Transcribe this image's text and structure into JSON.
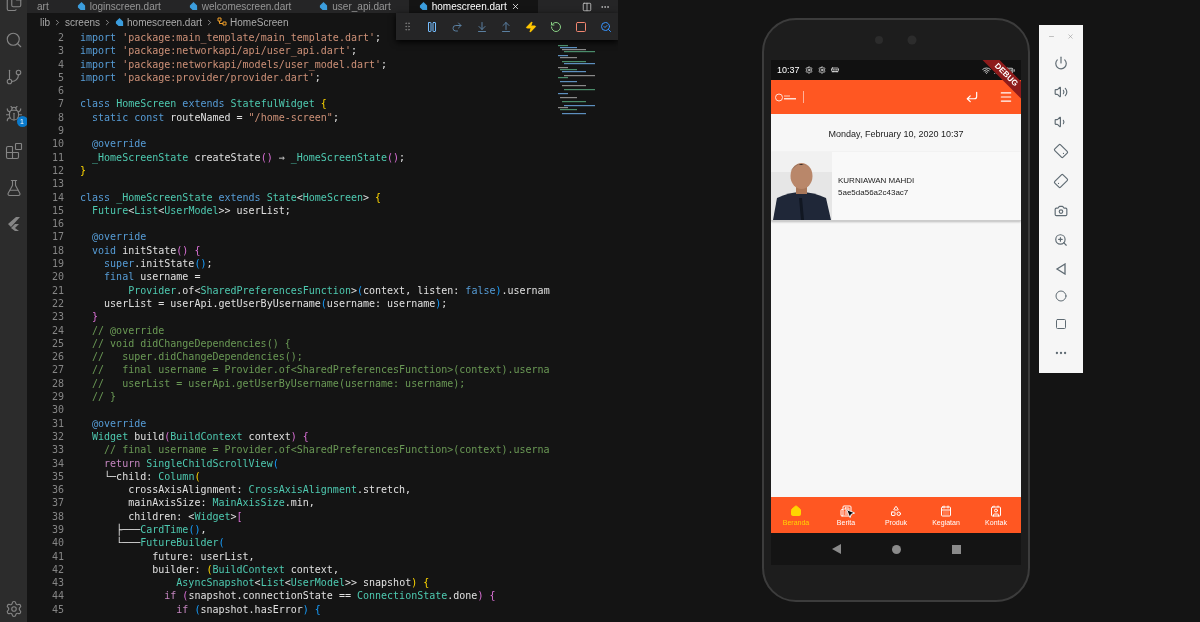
{
  "editor": {
    "activity_bar": {
      "debug_badge": "1"
    },
    "tabs": [
      {
        "label": "art",
        "kind": "cut",
        "selected": false
      },
      {
        "label": "loginscreen.dart",
        "kind": "file",
        "selected": false
      },
      {
        "label": "welcomescreen.dart",
        "kind": "file",
        "selected": false
      },
      {
        "label": "user_api.dart",
        "kind": "file",
        "selected": false
      },
      {
        "label": "homescreen.dart",
        "kind": "file",
        "selected": true
      }
    ],
    "breadcrumb": [
      {
        "label": "lib",
        "kind": "folder"
      },
      {
        "label": "screens",
        "kind": "folder"
      },
      {
        "label": "homescreen.dart",
        "kind": "file"
      },
      {
        "label": "HomeScreen",
        "kind": "class"
      }
    ],
    "lines": [
      {
        "number": "2",
        "tokens": [
          {
            "kind": "kw",
            "text": "import "
          },
          {
            "kind": "str",
            "text": "'package:main_template/main_template.dart'"
          },
          {
            "kind": "plain",
            "text": ";"
          }
        ]
      },
      {
        "number": "3",
        "tokens": [
          {
            "kind": "kw",
            "text": "import "
          },
          {
            "kind": "str",
            "text": "'package:networkapi/api/user_api.dart'"
          },
          {
            "kind": "plain",
            "text": ";"
          }
        ]
      },
      {
        "number": "4",
        "tokens": [
          {
            "kind": "kw",
            "text": "import "
          },
          {
            "kind": "str",
            "text": "'package:networkapi/models/user_model.dart'"
          },
          {
            "kind": "plain",
            "text": ";"
          }
        ]
      },
      {
        "number": "5",
        "tokens": [
          {
            "kind": "kw",
            "text": "import "
          },
          {
            "kind": "str",
            "text": "'package:provider/provider.dart'"
          },
          {
            "kind": "plain",
            "text": ";"
          }
        ]
      },
      {
        "number": "6"
      },
      {
        "number": "7",
        "tokens": [
          {
            "kind": "kw",
            "text": "class "
          },
          {
            "kind": "type",
            "text": "HomeScreen "
          },
          {
            "kind": "kw",
            "text": "extends "
          },
          {
            "kind": "type",
            "text": "StatefulWidget "
          },
          {
            "kind": "b1",
            "text": "{"
          }
        ]
      },
      {
        "number": "8",
        "tokens": [
          {
            "kind": "kw",
            "text": "  static const "
          },
          {
            "kind": "plain",
            "text": "routeNamed = "
          },
          {
            "kind": "str",
            "text": "\"/home-screen\""
          },
          {
            "kind": "plain",
            "text": ";"
          }
        ]
      },
      {
        "number": "9"
      },
      {
        "number": "10",
        "tokens": [
          {
            "kind": "kw",
            "text": "  @override"
          }
        ]
      },
      {
        "number": "11",
        "tokens": [
          {
            "kind": "type",
            "text": "  _HomeScreenState "
          },
          {
            "kind": "plain",
            "text": "createState"
          },
          {
            "kind": "b2",
            "text": "()"
          },
          {
            "kind": "plain",
            "text": " ⇒ "
          },
          {
            "kind": "type",
            "text": "_HomeScreenState"
          },
          {
            "kind": "b2",
            "text": "()"
          },
          {
            "kind": "plain",
            "text": ";"
          }
        ]
      },
      {
        "number": "12",
        "tokens": [
          {
            "kind": "b1",
            "text": "}"
          }
        ]
      },
      {
        "number": "13"
      },
      {
        "number": "14",
        "tokens": [
          {
            "kind": "kw",
            "text": "class "
          },
          {
            "kind": "type",
            "text": "_HomeScreenState "
          },
          {
            "kind": "kw",
            "text": "extends "
          },
          {
            "kind": "type",
            "text": "State"
          },
          {
            "kind": "plain",
            "text": "<"
          },
          {
            "kind": "type",
            "text": "HomeScreen"
          },
          {
            "kind": "plain",
            "text": "> "
          },
          {
            "kind": "b1",
            "text": "{"
          }
        ]
      },
      {
        "number": "15",
        "tokens": [
          {
            "kind": "type",
            "text": "  Future"
          },
          {
            "kind": "plain",
            "text": "<"
          },
          {
            "kind": "type",
            "text": "List"
          },
          {
            "kind": "plain",
            "text": "<"
          },
          {
            "kind": "type",
            "text": "UserModel"
          },
          {
            "kind": "plain",
            "text": ">> userList;"
          }
        ]
      },
      {
        "number": "16"
      },
      {
        "number": "17",
        "tokens": [
          {
            "kind": "kw",
            "text": "  @override"
          }
        ]
      },
      {
        "number": "18",
        "tokens": [
          {
            "kind": "kw",
            "text": "  void "
          },
          {
            "kind": "plain",
            "text": "initState"
          },
          {
            "kind": "b2",
            "text": "() {"
          }
        ]
      },
      {
        "number": "19",
        "tokens": [
          {
            "kind": "kw",
            "text": "    super"
          },
          {
            "kind": "plain",
            "text": ".initState"
          },
          {
            "kind": "b3",
            "text": "()"
          },
          {
            "kind": "plain",
            "text": ";"
          }
        ]
      },
      {
        "number": "20",
        "tokens": [
          {
            "kind": "kw",
            "text": "    final "
          },
          {
            "kind": "plain",
            "text": "username ="
          }
        ]
      },
      {
        "number": "21",
        "tokens": [
          {
            "kind": "type",
            "text": "        Provider"
          },
          {
            "kind": "plain",
            "text": ".of<"
          },
          {
            "kind": "type",
            "text": "SharedPreferencesFunction"
          },
          {
            "kind": "plain",
            "text": ">"
          },
          {
            "kind": "b3",
            "text": "("
          },
          {
            "kind": "plain",
            "text": "context, listen: "
          },
          {
            "kind": "kw",
            "text": "false"
          },
          {
            "kind": "b3",
            "text": ")"
          },
          {
            "kind": "plain",
            "text": ".usernam"
          }
        ]
      },
      {
        "number": "22",
        "tokens": [
          {
            "kind": "plain",
            "text": "    userList = userApi.getUserByUsername"
          },
          {
            "kind": "b3",
            "text": "("
          },
          {
            "kind": "plain",
            "text": "username: username"
          },
          {
            "kind": "b3",
            "text": ")"
          },
          {
            "kind": "plain",
            "text": ";"
          }
        ]
      },
      {
        "number": "23",
        "tokens": [
          {
            "kind": "b2",
            "text": "  }"
          }
        ]
      },
      {
        "number": "24",
        "tokens": [
          {
            "kind": "comment",
            "text": "  // @override"
          }
        ]
      },
      {
        "number": "25",
        "tokens": [
          {
            "kind": "comment",
            "text": "  // void didChangeDependencies() {"
          }
        ]
      },
      {
        "number": "26",
        "tokens": [
          {
            "kind": "comment",
            "text": "  //   super.didChangeDependencies();"
          }
        ]
      },
      {
        "number": "27",
        "tokens": [
          {
            "kind": "comment",
            "text": "  //   final username = Provider.of<SharedPreferencesFunction>(context).userna"
          }
        ]
      },
      {
        "number": "28",
        "tokens": [
          {
            "kind": "comment",
            "text": "  //   userList = userApi.getUserByUsername(username: username);"
          }
        ]
      },
      {
        "number": "29",
        "tokens": [
          {
            "kind": "comment",
            "text": "  // }"
          }
        ]
      },
      {
        "number": "30"
      },
      {
        "number": "31",
        "tokens": [
          {
            "kind": "kw",
            "text": "  @override"
          }
        ]
      },
      {
        "number": "32",
        "tokens": [
          {
            "kind": "type",
            "text": "  Widget "
          },
          {
            "kind": "plain",
            "text": "build"
          },
          {
            "kind": "b2",
            "text": "("
          },
          {
            "kind": "type",
            "text": "BuildContext "
          },
          {
            "kind": "plain",
            "text": "context"
          },
          {
            "kind": "b2",
            "text": ") {"
          }
        ]
      },
      {
        "number": "33",
        "tokens": [
          {
            "kind": "comment",
            "text": "    // final username = Provider.of<SharedPreferencesFunction>(context).userna"
          }
        ]
      },
      {
        "number": "34",
        "tokens": [
          {
            "kind": "ctrl",
            "text": "    return "
          },
          {
            "kind": "type",
            "text": "SingleChildScrollView"
          },
          {
            "kind": "b3",
            "text": "("
          }
        ]
      },
      {
        "number": "35",
        "tokens": [
          {
            "kind": "plain",
            "text": "    └─child: "
          },
          {
            "kind": "type",
            "text": "Column"
          },
          {
            "kind": "b1",
            "text": "("
          }
        ]
      },
      {
        "number": "36",
        "tokens": [
          {
            "kind": "plain",
            "text": "        crossAxisAlignment: "
          },
          {
            "kind": "type",
            "text": "CrossAxisAlignment"
          },
          {
            "kind": "plain",
            "text": ".stretch,"
          }
        ]
      },
      {
        "number": "37",
        "tokens": [
          {
            "kind": "plain",
            "text": "        mainAxisSize: "
          },
          {
            "kind": "type",
            "text": "MainAxisSize"
          },
          {
            "kind": "plain",
            "text": ".min,"
          }
        ]
      },
      {
        "number": "38",
        "tokens": [
          {
            "kind": "plain",
            "text": "        children: <"
          },
          {
            "kind": "type",
            "text": "Widget"
          },
          {
            "kind": "plain",
            "text": ">"
          },
          {
            "kind": "b2",
            "text": "["
          }
        ]
      },
      {
        "number": "39",
        "tokens": [
          {
            "kind": "plain",
            "text": "      ├───"
          },
          {
            "kind": "type",
            "text": "CardTime"
          },
          {
            "kind": "b3",
            "text": "()"
          },
          {
            "kind": "plain",
            "text": ","
          }
        ]
      },
      {
        "number": "40",
        "tokens": [
          {
            "kind": "plain",
            "text": "      └───"
          },
          {
            "kind": "type",
            "text": "FutureBuilder"
          },
          {
            "kind": "b3",
            "text": "("
          }
        ]
      },
      {
        "number": "41",
        "tokens": [
          {
            "kind": "plain",
            "text": "            future: userList,"
          }
        ]
      },
      {
        "number": "42",
        "tokens": [
          {
            "kind": "plain",
            "text": "            builder: "
          },
          {
            "kind": "b1",
            "text": "("
          },
          {
            "kind": "type",
            "text": "BuildContext "
          },
          {
            "kind": "plain",
            "text": "context,"
          }
        ]
      },
      {
        "number": "43",
        "tokens": [
          {
            "kind": "type",
            "text": "                AsyncSnapshot"
          },
          {
            "kind": "plain",
            "text": "<"
          },
          {
            "kind": "type",
            "text": "List"
          },
          {
            "kind": "plain",
            "text": "<"
          },
          {
            "kind": "type",
            "text": "UserModel"
          },
          {
            "kind": "plain",
            "text": ">> snapshot"
          },
          {
            "kind": "b1",
            "text": ") {"
          }
        ]
      },
      {
        "number": "44",
        "tokens": [
          {
            "kind": "ctrl",
            "text": "              if "
          },
          {
            "kind": "b2",
            "text": "("
          },
          {
            "kind": "plain",
            "text": "snapshot.connectionState == "
          },
          {
            "kind": "type",
            "text": "ConnectionState"
          },
          {
            "kind": "plain",
            "text": ".done"
          },
          {
            "kind": "b2",
            "text": ") {"
          }
        ]
      },
      {
        "number": "45",
        "tokens": [
          {
            "kind": "ctrl",
            "text": "                if "
          },
          {
            "kind": "b3",
            "text": "("
          },
          {
            "kind": "plain",
            "text": "snapshot.hasError"
          },
          {
            "kind": "b3",
            "text": ") {"
          }
        ]
      }
    ]
  },
  "phone": {
    "status_bar": {
      "time": "10:37"
    },
    "debug_banner": "DEBUG",
    "date": "Monday, February 10, 2020 10:37",
    "user": {
      "name": "KURNIAWAN MAHDI",
      "id": "5ae5da56a2c43ac7"
    },
    "bottom_nav": [
      {
        "label": "Beranda",
        "selected": true
      },
      {
        "label": "Berita",
        "selected": false
      },
      {
        "label": "Produk",
        "selected": false
      },
      {
        "label": "Kegiatan",
        "selected": false
      },
      {
        "label": "Kontak",
        "selected": false
      }
    ]
  }
}
